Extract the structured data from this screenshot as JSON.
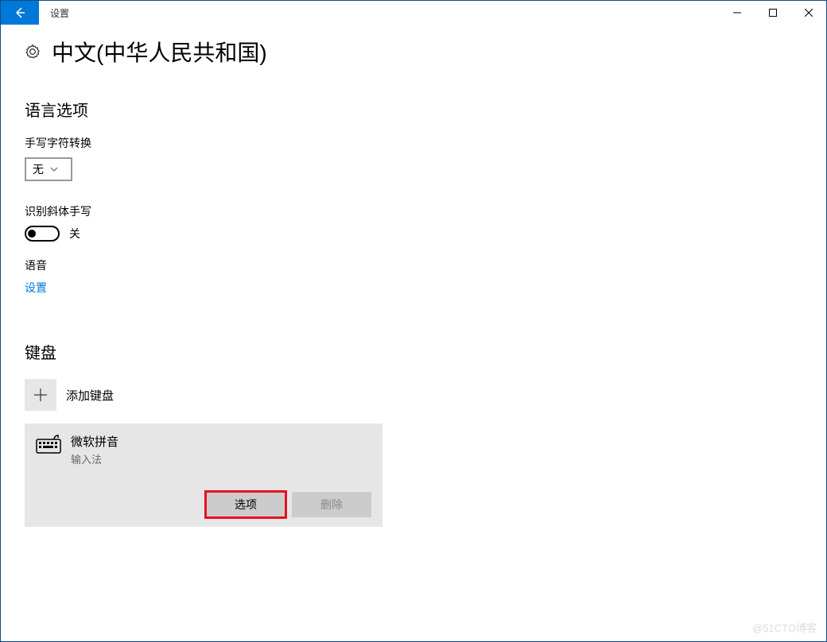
{
  "titlebar": {
    "title": "设置"
  },
  "header": {
    "page_title": "中文(中华人民共和国)"
  },
  "language_options": {
    "section": "语言选项",
    "handwriting_label": "手写字符转换",
    "handwriting_value": "无",
    "italic_label": "识别斜体手写",
    "italic_toggle_state": "关",
    "voice_label": "语音",
    "voice_link": "设置"
  },
  "keyboard": {
    "section": "键盘",
    "add_label": "添加键盘",
    "ime": {
      "name": "微软拼音",
      "subtitle": "输入法",
      "options_btn": "选项",
      "delete_btn": "删除"
    }
  },
  "watermark": "@51CTO博客"
}
